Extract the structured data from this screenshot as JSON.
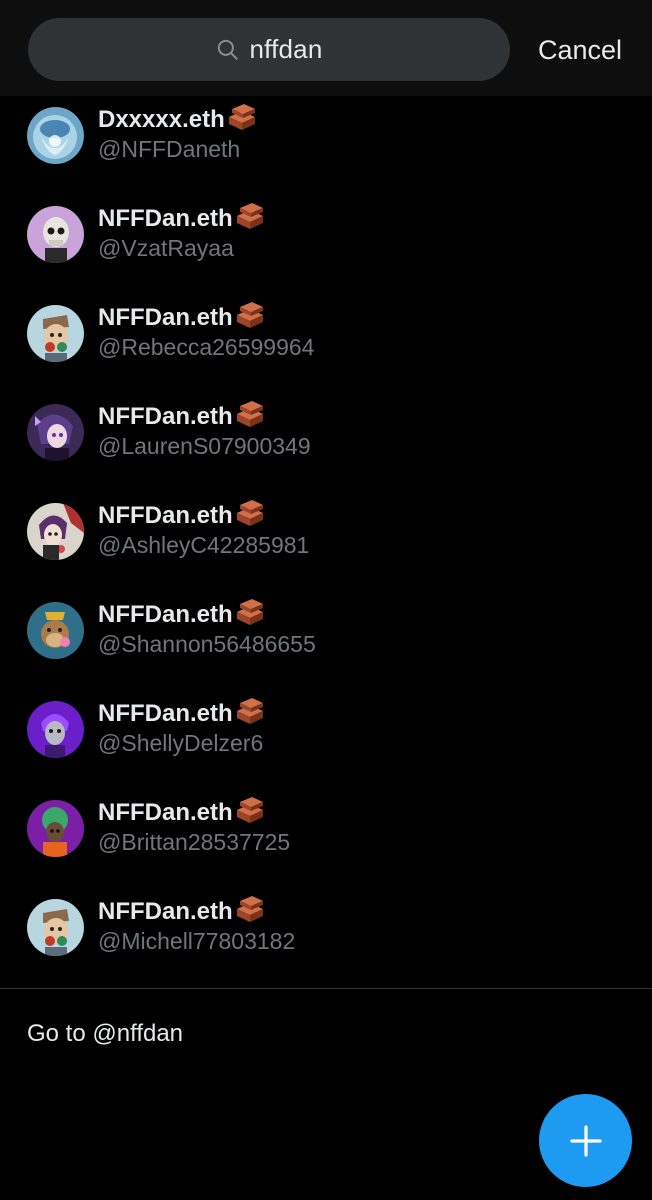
{
  "search": {
    "query": "nffdan",
    "cancel_label": "Cancel",
    "icon": "search-icon"
  },
  "results": [
    {
      "name": "Dxxxxx.eth",
      "handle": "@NFFDaneth",
      "badge_icon": "brick-icon"
    },
    {
      "name": "NFFDan.eth",
      "handle": "@VzatRayaa",
      "badge_icon": "brick-icon"
    },
    {
      "name": "NFFDan.eth",
      "handle": "@Rebecca26599964",
      "badge_icon": "brick-icon"
    },
    {
      "name": "NFFDan.eth",
      "handle": "@LaurenS07900349",
      "badge_icon": "brick-icon"
    },
    {
      "name": "NFFDan.eth",
      "handle": "@AshleyC42285981",
      "badge_icon": "brick-icon"
    },
    {
      "name": "NFFDan.eth",
      "handle": "@Shannon56486655",
      "badge_icon": "brick-icon"
    },
    {
      "name": "NFFDan.eth",
      "handle": "@ShellyDelzer6",
      "badge_icon": "brick-icon"
    },
    {
      "name": "NFFDan.eth",
      "handle": "@Brittan28537725",
      "badge_icon": "brick-icon"
    },
    {
      "name": "NFFDan.eth",
      "handle": "@Michell77803182",
      "badge_icon": "brick-icon"
    }
  ],
  "goto_label": "Go to @nffdan",
  "fab": {
    "icon": "plus-icon"
  },
  "colors": {
    "background": "#000000",
    "header": "#0e0e0e",
    "search_pill": "#2f3336",
    "primary_text": "#e7e9ea",
    "secondary_text": "#71767b",
    "accent": "#1d9bf0",
    "brick": "#b5532f"
  }
}
